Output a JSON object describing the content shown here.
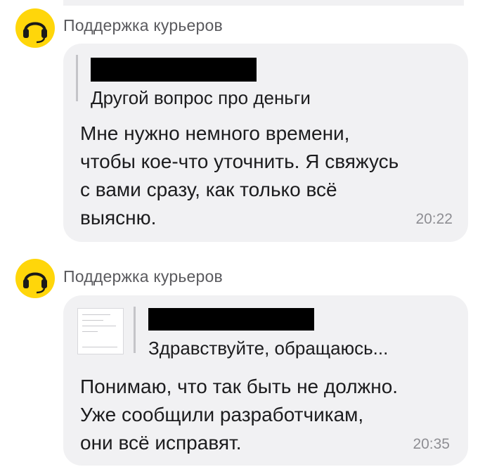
{
  "messages": [
    {
      "sender": "Поддержка курьеров",
      "avatar_icon": "headset-icon",
      "quote_text": "Другой вопрос про деньги",
      "body_lines": [
        "Мне нужно немного времени,",
        "чтобы кое-что уточнить. Я свяжусь",
        "с вами сразу, как только всё",
        "выясню."
      ],
      "time": "20:22"
    },
    {
      "sender": "Поддержка курьеров",
      "avatar_icon": "headset-icon",
      "quote_text": "Здравствуйте, обращаюсь...",
      "body_lines": [
        "Понимаю, что так быть не должно.",
        "Уже сообщили разработчикам,",
        "они всё исправят."
      ],
      "time": "20:35"
    }
  ],
  "colors": {
    "avatar": "#ffd60a",
    "bubble": "#f1f1f3",
    "text": "#1c1c1e",
    "secondary": "#8e8e93"
  }
}
